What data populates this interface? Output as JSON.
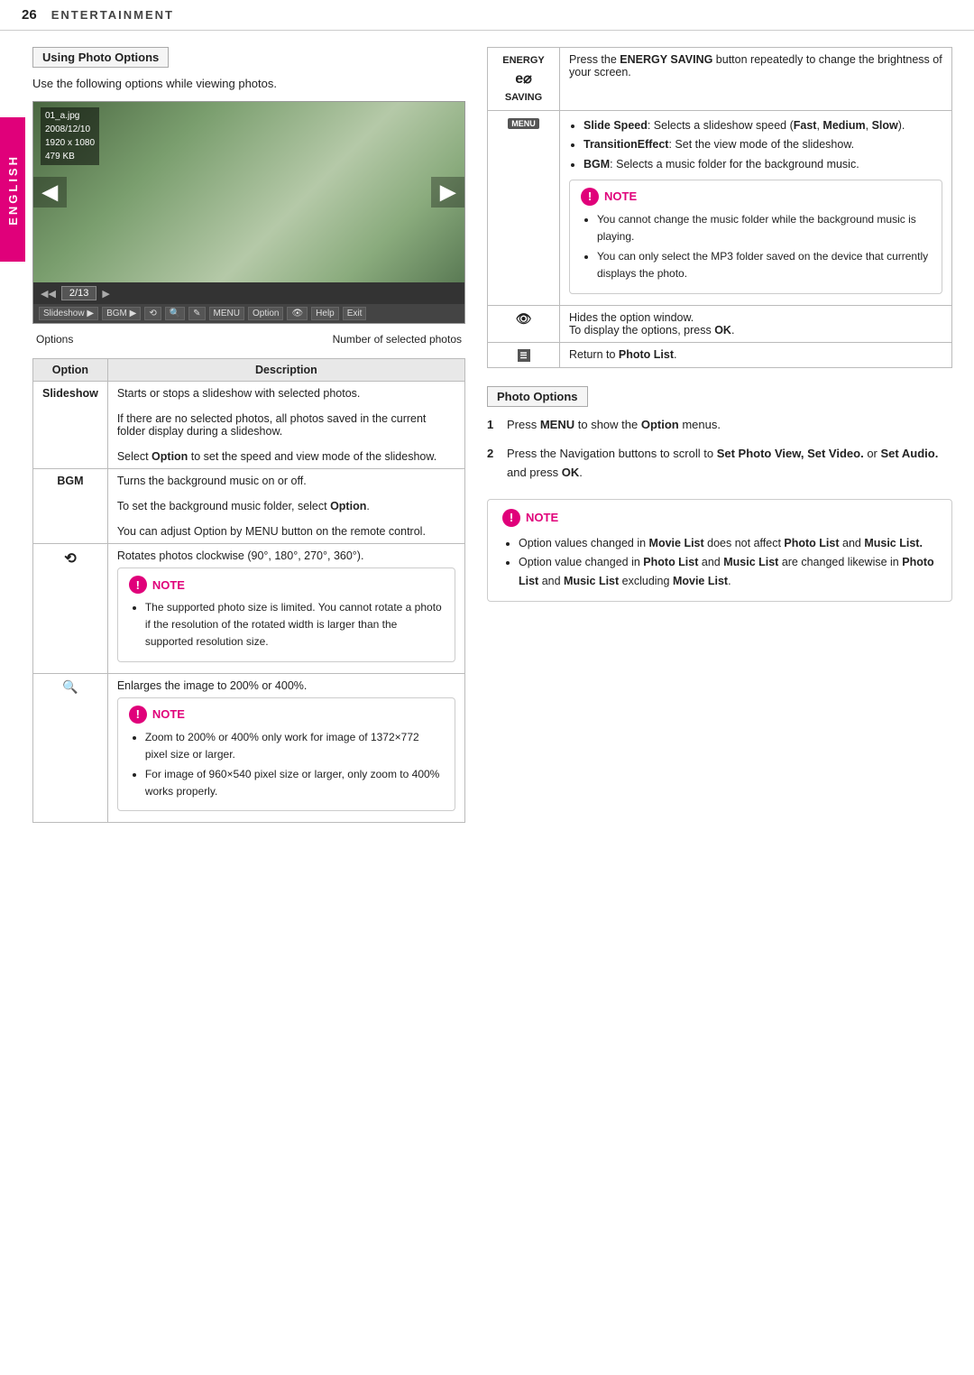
{
  "header": {
    "page_number": "26",
    "title": "ENTERTAINMENT"
  },
  "english_tab": "ENGLISH",
  "left": {
    "section_heading": "Using Photo Options",
    "intro": "Use the following options while viewing photos.",
    "photo_info": {
      "filename": "01_a.jpg",
      "date": "2008/12/10",
      "resolution": "1920 x 1080",
      "size": "479 KB"
    },
    "photo_counter": "2/13",
    "labels": {
      "options": "Options",
      "number": "Number of selected photos"
    },
    "table": {
      "headers": [
        "Option",
        "Description"
      ],
      "rows": [
        {
          "option": "Slideshow",
          "description": "Starts or stops a slideshow with selected photos.\nIf there are no selected photos, all photos saved in the current folder display during a slideshow.\nSelect Option to set the speed and view mode of the slideshow."
        },
        {
          "option": "BGM",
          "description": "Turns the background music on or off.\nTo set the background music folder, select Option.\nYou can adjust Option by MENU button on the remote control."
        },
        {
          "option": "rotate",
          "description": "Rotates photos clockwise (90°, 180°, 270°, 360°).",
          "note": {
            "bullets": [
              "The supported photo size is limited. You cannot rotate a photo if the resolution of the rotated width is larger than the supported resolution size."
            ]
          }
        },
        {
          "option": "zoom",
          "description": "Enlarges the image to 200% or 400%.",
          "note": {
            "bullets": [
              "Zoom to 200% or 400% only work for image of 1372×772 pixel size or larger.",
              "For image of 960×540 pixel size or larger, only zoom to 400% works properly."
            ]
          }
        }
      ]
    }
  },
  "right": {
    "table_rows": [
      {
        "key": "ENERGY\ne⊘\nSAVING",
        "value": "Press the ENERGY SAVING button repeatedly to change the brightness of your screen."
      },
      {
        "key": "MENU",
        "bullets": [
          "Slide Speed: Selects a slideshow speed (Fast, Medium, Slow).",
          "TransitionEffect: Set the view mode of the slideshow.",
          "BGM: Selects a music folder for the background music."
        ],
        "note": {
          "bullets": [
            "You cannot change the music folder while the background music is playing.",
            "You can only select the MP3 folder saved on the device that currently displays the photo."
          ]
        }
      },
      {
        "key": "hide",
        "value": "Hides the option window.\nTo display the options, press OK."
      },
      {
        "key": "list",
        "value": "Return to Photo List."
      }
    ],
    "photo_options": {
      "heading": "Photo Options",
      "steps": [
        {
          "num": "1",
          "text": "Press MENU to show the Option menus."
        },
        {
          "num": "2",
          "text": "Press the Navigation buttons to scroll to Set Photo View, Set Video. or Set Audio. and press OK."
        }
      ]
    },
    "bottom_note": {
      "bullets": [
        "Option values changed in Movie List does not affect Photo List and Music List.",
        "Option value changed in Photo List and Music List are changed likewise in Photo List and Music List excluding Movie List."
      ]
    }
  }
}
